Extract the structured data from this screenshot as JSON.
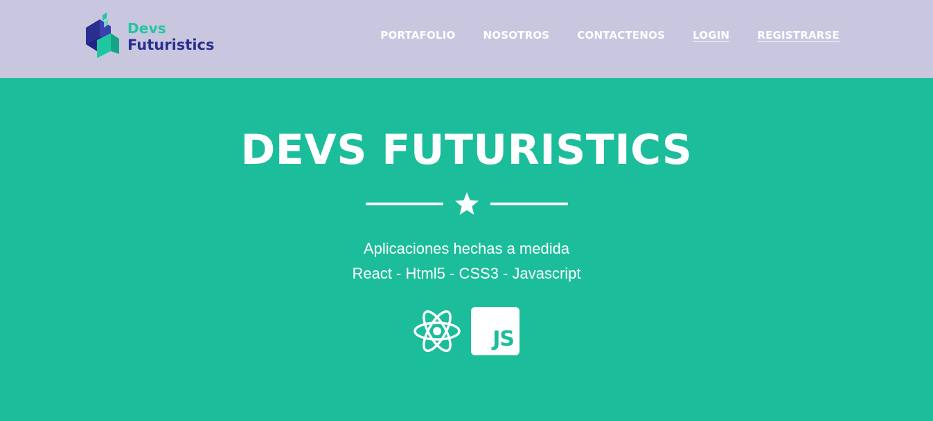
{
  "brand": {
    "line1": "Devs",
    "line2": "Futuristics",
    "line1_color": "#1fc7a0",
    "line2_color": "#2a2f8f"
  },
  "nav": {
    "items": [
      {
        "label": "PORTAFOLIO",
        "underlined": false
      },
      {
        "label": "NOSOTROS",
        "underlined": false
      },
      {
        "label": "CONTACTENOS",
        "underlined": false
      },
      {
        "label": "LOGIN",
        "underlined": true
      },
      {
        "label": "REGISTRARSE",
        "underlined": true
      }
    ]
  },
  "hero": {
    "title": "DEVS FUTURISTICS",
    "subtitle_line1": "Aplicaciones hechas a medida",
    "subtitle_line2": "React - Html5 - CSS3 - Javascript",
    "divider_icon": "star-icon",
    "tech_icons": [
      "react-icon",
      "javascript-icon"
    ],
    "js_label": "JS"
  },
  "colors": {
    "navbar_bg": "#c9c7e0",
    "hero_bg": "#1bbd9b",
    "text": "#ffffff"
  }
}
